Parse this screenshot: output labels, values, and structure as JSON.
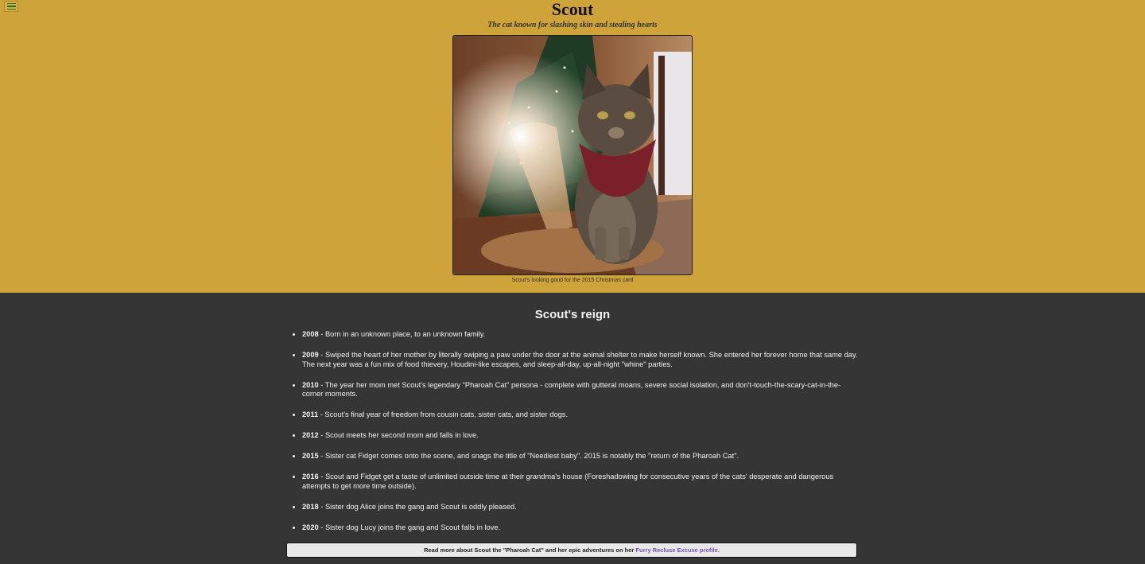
{
  "header": {
    "menu_icon": "hamburger-icon",
    "title": "Scout",
    "subtitle": "The cat known for slashing skin and stealing hearts"
  },
  "photo": {
    "caption": "Scout's looking good for the 2015 Christmas card"
  },
  "reign": {
    "heading": "Scout's reign",
    "items": [
      {
        "year": "2008",
        "text": " - Born in an unknown place, to an unknown family."
      },
      {
        "year": "2009",
        "text": " - Swiped the heart of her mother by literally swiping a paw under the door at the animal shelter to make herself known. She entered her forever home that same day. The next year was a fun mix of food thievery, Houdini-like escapes, and sleep-all-day, up-all-night \"whine\" parties."
      },
      {
        "year": "2010",
        "text": " - The year her mom met Scout's legendary \"Pharoah Cat\" persona - complete with gutteral moans, severe social isolation, and don't-touch-the-scary-cat-in-the-corner moments."
      },
      {
        "year": "2011",
        "text": " - Scout's final year of freedom from cousin cats, sister cats, and sister dogs."
      },
      {
        "year": "2012",
        "text": " - Scout meets her second mom and falls in love."
      },
      {
        "year": "2015",
        "text": " - Sister cat Fidget comes onto the scene, and snags the title of \"Neediest baby\". 2015 is notably the \"return of the Pharoah Cat\"."
      },
      {
        "year": "2016",
        "text": " - Scout and Fidget get a taste of unlimited outside time at their grandma's house (Foreshadowing for consecutive years of the cats' desperate and dangerous attempts to get more time outside)."
      },
      {
        "year": "2018",
        "text": " - Sister dog Alice joins the gang and Scout is oddly pleased."
      },
      {
        "year": "2020",
        "text": " - Sister dog Lucy joins the gang and Scout falls in love."
      }
    ]
  },
  "footer": {
    "text": "Read more about Scout the \"Pharoah Cat\" and her epic adventures on her ",
    "link_text": "Furry Recluse Excuse profile."
  },
  "colors": {
    "header_bg": "#cda33a",
    "body_bg": "#353535",
    "link": "#7a4fc0"
  }
}
